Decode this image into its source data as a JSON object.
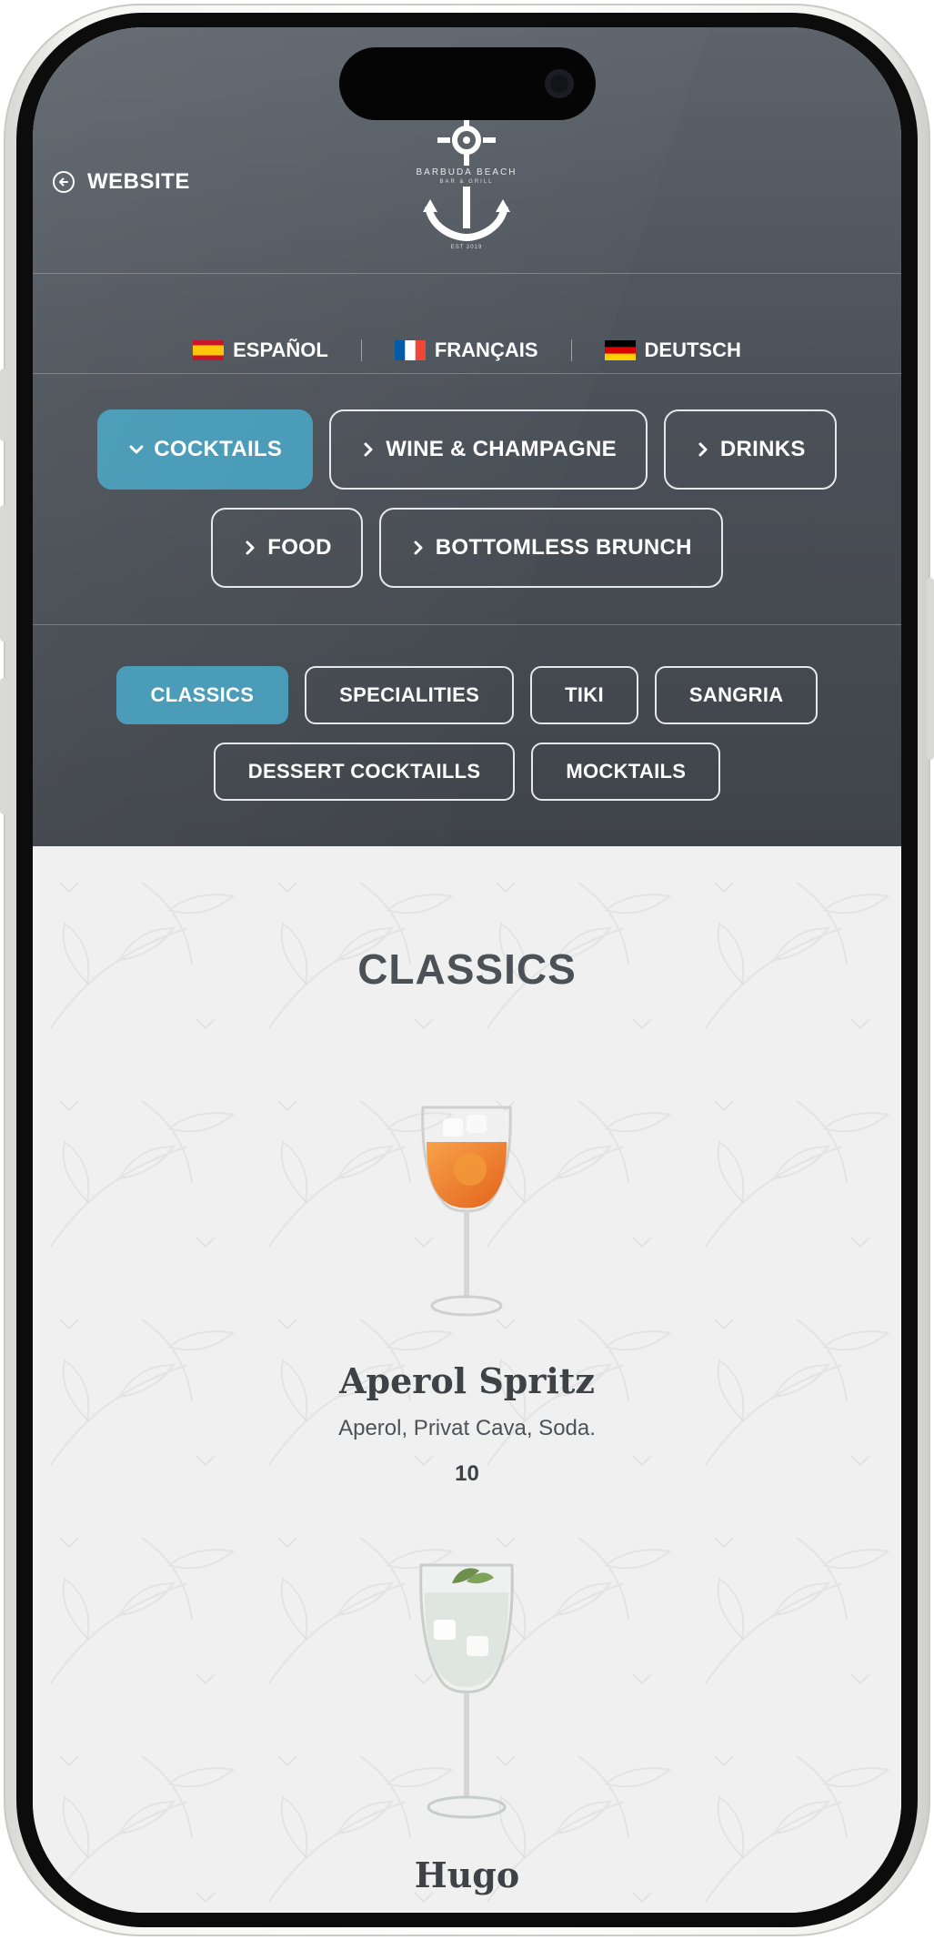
{
  "header": {
    "back_label": "WEBSITE",
    "logo": {
      "name": "BARBUDA BEACH",
      "subtitle": "BAR & GRILL",
      "est": "EST 2019"
    }
  },
  "languages": [
    {
      "label": "ESPAÑOL",
      "flag": "es"
    },
    {
      "label": "FRANÇAIS",
      "flag": "fr"
    },
    {
      "label": "DEUTSCH",
      "flag": "de"
    }
  ],
  "categories": [
    {
      "label": "COCKTAILS",
      "active": true
    },
    {
      "label": "WINE & CHAMPAGNE",
      "active": false
    },
    {
      "label": "DRINKS",
      "active": false
    },
    {
      "label": "FOOD",
      "active": false
    },
    {
      "label": "BOTTOMLESS BRUNCH",
      "active": false
    }
  ],
  "subcategories": [
    {
      "label": "CLASSICS",
      "active": true
    },
    {
      "label": "SPECIALITIES",
      "active": false
    },
    {
      "label": "TIKI",
      "active": false
    },
    {
      "label": "SANGRIA",
      "active": false
    },
    {
      "label": "DESSERT COCKTAILLS",
      "active": false
    },
    {
      "label": "MOCKTAILS",
      "active": false
    }
  ],
  "section": {
    "title": "CLASSICS"
  },
  "items": [
    {
      "name": "Aperol Spritz",
      "description": "Aperol, Privat Cava, Soda.",
      "price": "10"
    },
    {
      "name": "Hugo"
    }
  ],
  "colors": {
    "accent": "#4599b6",
    "header_bg": "#4b5158",
    "content_bg": "#f0f0f0",
    "text_dark": "#3e4246"
  }
}
